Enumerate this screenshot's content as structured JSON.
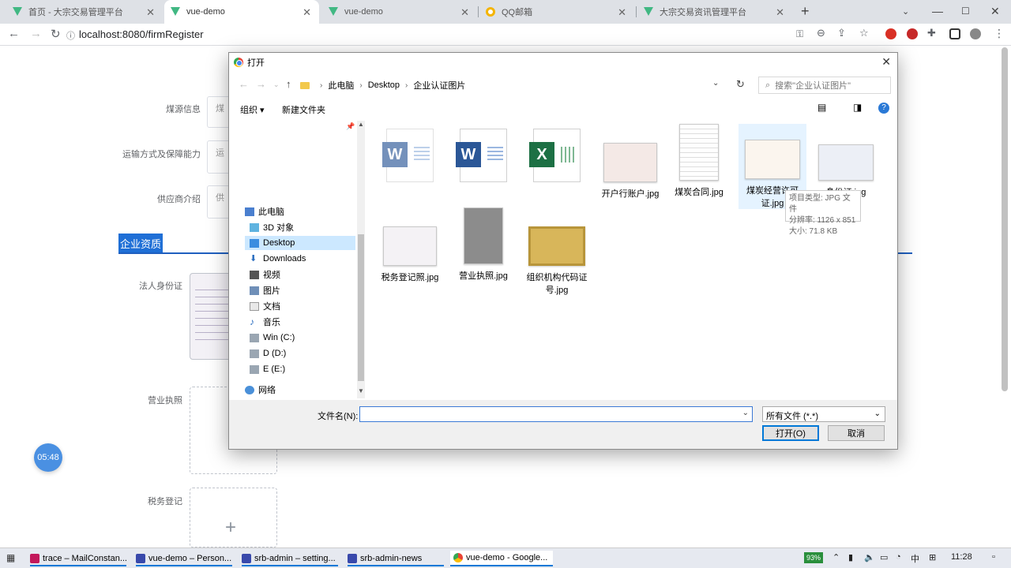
{
  "browser": {
    "tabs": [
      {
        "title": "首页 - 大宗交易管理平台",
        "icon": "vue-icon"
      },
      {
        "title": "vue-demo",
        "icon": "vue-icon"
      },
      {
        "title": "vue-demo",
        "icon": "vue-icon"
      },
      {
        "title": "QQ邮箱",
        "icon": "qq-mail-icon"
      },
      {
        "title": "大宗交易资讯管理平台",
        "icon": "vue-icon"
      }
    ],
    "url": "localhost:8080/firmRegister",
    "close_glyph": "✕",
    "new_tab_glyph": "+"
  },
  "page": {
    "fields": [
      {
        "label": "煤源信息",
        "value": "煤"
      },
      {
        "label": "运输方式及保障能力",
        "value": "运"
      },
      {
        "label": "供应商介绍",
        "value": "供"
      }
    ],
    "section_title": "企业资质",
    "uploads": [
      {
        "label": "法人身份证"
      },
      {
        "label": "营业执照"
      },
      {
        "label": "税务登记"
      }
    ],
    "plus_glyph": "+",
    "timer": "05:48"
  },
  "dialog": {
    "title": "打开",
    "breadcrumb": [
      "此电脑",
      "Desktop",
      "企业认证图片"
    ],
    "search_placeholder": "搜索\"企业认证图片\"",
    "toolbar": {
      "organize": "组织 ▾",
      "new_folder": "新建文件夹",
      "help": "?"
    },
    "sidebar": [
      {
        "label": "此电脑",
        "icon": "computer-icon"
      },
      {
        "label": "3D 对象",
        "icon": "3d-objects-icon"
      },
      {
        "label": "Desktop",
        "icon": "desktop-icon",
        "selected": true
      },
      {
        "label": "Downloads",
        "icon": "downloads-icon"
      },
      {
        "label": "视频",
        "icon": "videos-icon"
      },
      {
        "label": "图片",
        "icon": "pictures-icon"
      },
      {
        "label": "文档",
        "icon": "documents-icon"
      },
      {
        "label": "音乐",
        "icon": "music-icon"
      },
      {
        "label": "Win (C:)",
        "icon": "drive-icon"
      },
      {
        "label": "D (D:)",
        "icon": "drive-icon"
      },
      {
        "label": "E (E:)",
        "icon": "drive-icon"
      },
      {
        "label": "网络",
        "icon": "network-icon"
      }
    ],
    "files": [
      {
        "name": "",
        "kind": "word-doc"
      },
      {
        "name": "",
        "kind": "word-doc"
      },
      {
        "name": "",
        "kind": "excel-doc"
      },
      {
        "name": "开户行账户.jpg",
        "kind": "image"
      },
      {
        "name": "煤炭合同.jpg",
        "kind": "image"
      },
      {
        "name": "煤炭经营许可证.jpg",
        "kind": "image"
      },
      {
        "name": "身份证.jpg",
        "kind": "image"
      },
      {
        "name": "税务登记照.jpg",
        "kind": "image"
      },
      {
        "name": "营业执照.jpg",
        "kind": "image"
      },
      {
        "name": "组织机构代码证号.jpg",
        "kind": "image"
      }
    ],
    "tooltip": {
      "type": "项目类型: JPG 文件",
      "resolution": "分辨率: 1126 x 851",
      "size": "大小: 71.8 KB"
    },
    "filename_label": "文件名(N):",
    "filename_value": "",
    "filetype": "所有文件 (*.*)",
    "open_button": "打开(O)",
    "cancel_button": "取消"
  },
  "taskbar": {
    "items": [
      {
        "label": "trace – MailConstan..."
      },
      {
        "label": "vue-demo – Person..."
      },
      {
        "label": "srb-admin – setting..."
      },
      {
        "label": "srb-admin-news"
      },
      {
        "label": "vue-demo - Google..."
      }
    ],
    "battery": "93%",
    "ime": "中",
    "clock": "11:28"
  },
  "colors": {
    "accent": "#1f6fd6",
    "dialog_selection": "#cce8ff",
    "primary_button_border": "#0078d7"
  }
}
